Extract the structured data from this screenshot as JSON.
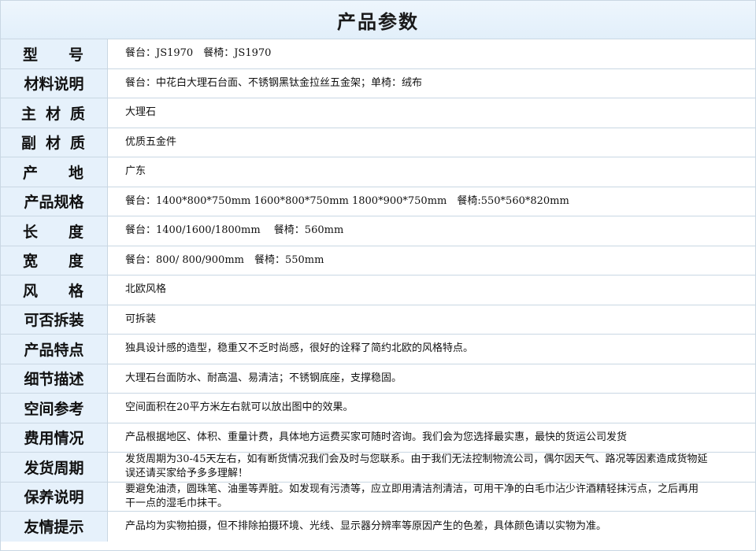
{
  "title": "产品参数",
  "rows": [
    {
      "label_chars": [
        "型",
        "号"
      ],
      "value": "餐台：JS1970　餐椅：JS1970"
    },
    {
      "label": "材料说明",
      "value": "餐台：中花白大理石台面、不锈钢黑钛金拉丝五金架；单椅：绒布"
    },
    {
      "label_chars": [
        "主",
        "材",
        "质"
      ],
      "value": "大理石"
    },
    {
      "label_chars": [
        "副",
        "材",
        "质"
      ],
      "value": "优质五金件"
    },
    {
      "label_chars": [
        "产",
        "地"
      ],
      "value": "广东"
    },
    {
      "label": "产品规格",
      "value": "餐台：1400*800*750mm 1600*800*750mm 1800*900*750mm　餐椅:550*560*820mm"
    },
    {
      "label_chars": [
        "长",
        "度"
      ],
      "value": "餐台：1400/1600/1800mm　 餐椅：560mm"
    },
    {
      "label_chars": [
        "宽",
        "度"
      ],
      "value": "餐台：800/ 800/900mm　餐椅：550mm"
    },
    {
      "label_chars": [
        "风",
        "格"
      ],
      "value": "北欧风格"
    },
    {
      "label": "可否拆装",
      "value": "可拆装"
    },
    {
      "label": "产品特点",
      "value": "独具设计感的造型，稳重又不乏时尚感，很好的诠释了简约北欧的风格特点。"
    },
    {
      "label": "细节描述",
      "value": "大理石台面防水、耐高温、易清洁；不锈钢底座，支撑稳固。"
    },
    {
      "label": "空间参考",
      "value": "空间面积在20平方米左右就可以放出图中的效果。"
    },
    {
      "label": "费用情况",
      "value": "产品根据地区、体积、重量计费，具体地方运费买家可随时咨询。我们会为您选择最实惠，最快的货运公司发货"
    },
    {
      "label": "发货周期",
      "value": "发货周期为30-45天左右，如有断货情况我们会及时与您联系。由于我们无法控制物流公司，偶尔因天气、路况等因素造成货物延误还请买家给予多多理解！"
    },
    {
      "label": "保养说明",
      "value": "要避免油渍，圆珠笔、油墨等弄脏。如发现有污渍等，应立即用清洁剂清洁，可用干净的白毛巾沾少许酒精轻抹污点，之后再用干一点的湿毛巾抹干。"
    },
    {
      "label": "友情提示",
      "value": "产品均为实物拍摄，但不排除拍摄环境、光线、显示器分辨率等原因产生的色差，具体颜色请以实物为准。"
    }
  ]
}
